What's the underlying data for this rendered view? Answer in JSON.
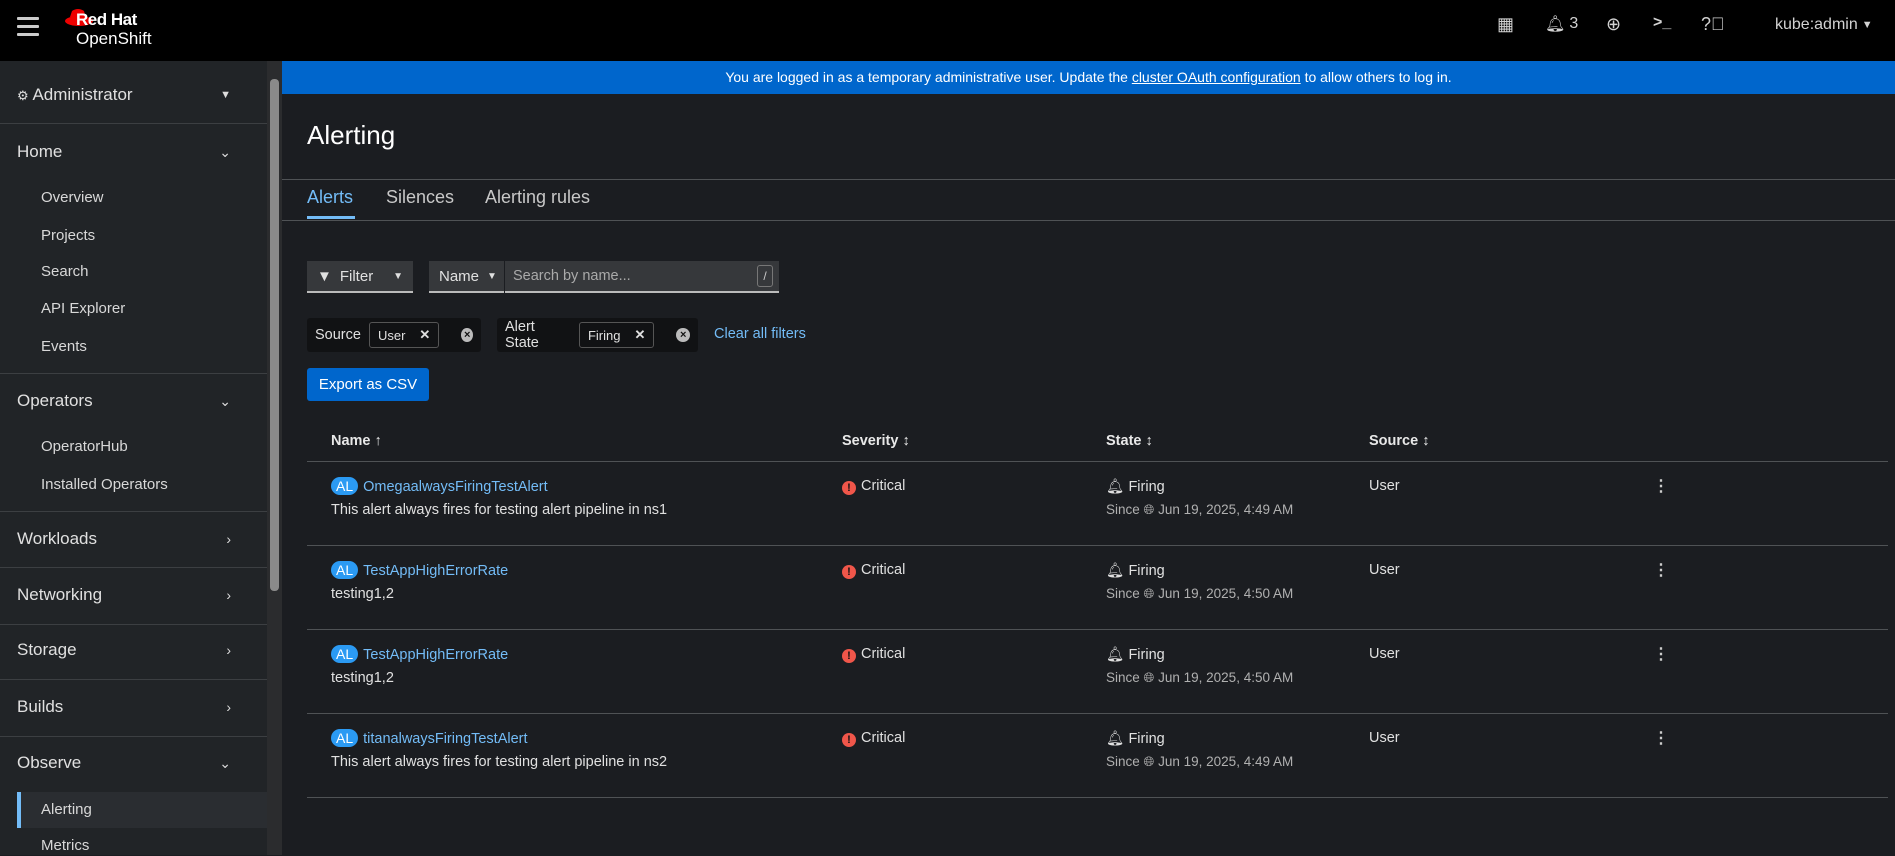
{
  "brand": {
    "line1": "Red Hat",
    "line2": "OpenShift"
  },
  "topbar": {
    "notifications_count": "3",
    "user": "kube:admin"
  },
  "banner": {
    "before": "You are logged in as a temporary administrative user. Update the ",
    "link": "cluster OAuth configuration",
    "after": " to allow others to log in."
  },
  "sidebar": {
    "perspective": "Administrator",
    "sections": [
      {
        "label": "Home",
        "items": [
          "Overview",
          "Projects",
          "Search",
          "API Explorer",
          "Events"
        ]
      },
      {
        "label": "Operators",
        "items": [
          "OperatorHub",
          "Installed Operators"
        ]
      },
      {
        "label": "Workloads"
      },
      {
        "label": "Networking"
      },
      {
        "label": "Storage"
      },
      {
        "label": "Builds"
      },
      {
        "label": "Observe",
        "items": [
          "Alerting",
          "Metrics"
        ]
      }
    ]
  },
  "page": {
    "title": "Alerting",
    "tabs": [
      "Alerts",
      "Silences",
      "Alerting rules"
    ]
  },
  "toolbar": {
    "filter": "Filter",
    "name_select": "Name",
    "search_placeholder": "Search by name...",
    "shortcut": "/",
    "chips": [
      {
        "category": "Source",
        "value": "User"
      },
      {
        "category": "Alert State",
        "value": "Firing"
      }
    ],
    "clear": "Clear all filters",
    "export": "Export as CSV"
  },
  "table": {
    "headers": [
      "Name",
      "Severity",
      "State",
      "Source"
    ],
    "rows": [
      {
        "badge": "AL",
        "name": "OmegaalwaysFiringTestAlert",
        "desc": "This alert always fires for testing alert pipeline in ns1",
        "severity": "Critical",
        "state": "Firing",
        "since": "Since",
        "time": "Jun 19, 2025, 4:49 AM",
        "source": "User"
      },
      {
        "badge": "AL",
        "name": "TestAppHighErrorRate",
        "desc": "testing1,2",
        "severity": "Critical",
        "state": "Firing",
        "since": "Since",
        "time": "Jun 19, 2025, 4:50 AM",
        "source": "User"
      },
      {
        "badge": "AL",
        "name": "TestAppHighErrorRate",
        "desc": "testing1,2",
        "severity": "Critical",
        "state": "Firing",
        "since": "Since",
        "time": "Jun 19, 2025, 4:50 AM",
        "source": "User"
      },
      {
        "badge": "AL",
        "name": "titanalwaysFiringTestAlert",
        "desc": "This alert always fires for testing alert pipeline in ns2",
        "severity": "Critical",
        "state": "Firing",
        "since": "Since",
        "time": "Jun 19, 2025, 4:49 AM",
        "source": "User"
      }
    ]
  }
}
